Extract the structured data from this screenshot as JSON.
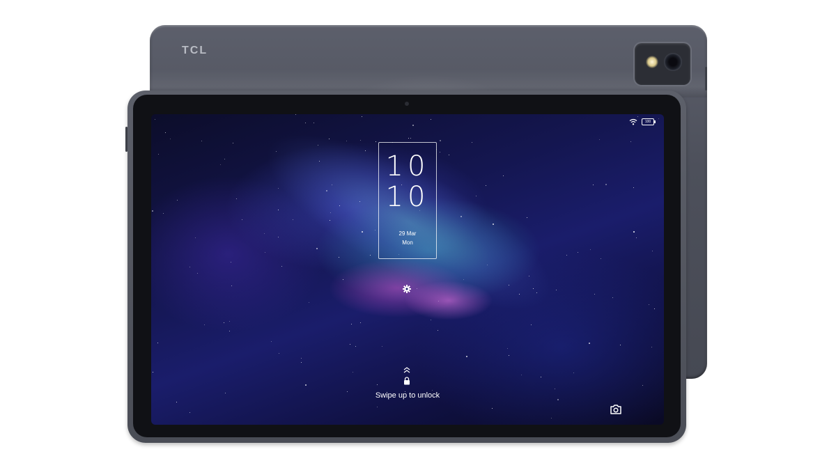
{
  "device": {
    "brand": "TCL"
  },
  "status_bar": {
    "wifi_icon": "wifi-icon",
    "battery_level": "100"
  },
  "lock_screen": {
    "clock_hours": "10",
    "clock_minutes": "10",
    "date": "29 Mar",
    "day": "Mon",
    "settings_icon": "gear-icon",
    "swipe_icon": "chevron-up-icon",
    "lock_icon": "lock-icon",
    "unlock_hint": "Swipe up to unlock",
    "camera_icon": "camera-icon"
  },
  "colors": {
    "device_body": "#4e515b",
    "screen_base": "#141650",
    "galaxy_pink": "#cd50c8",
    "galaxy_cyan": "#3cbed2"
  }
}
